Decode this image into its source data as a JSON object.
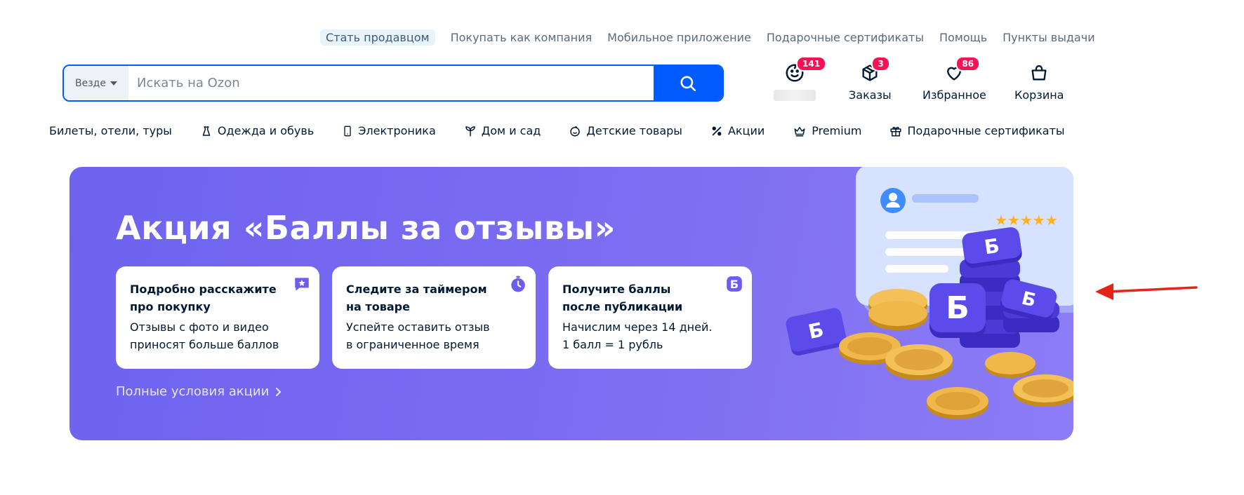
{
  "top_links": [
    {
      "label": "Стать продавцом"
    },
    {
      "label": "Покупать как компания"
    },
    {
      "label": "Мобильное приложение"
    },
    {
      "label": "Подарочные сертификаты"
    },
    {
      "label": "Помощь"
    },
    {
      "label": "Пункты выдачи"
    }
  ],
  "search": {
    "scope": "Везде",
    "placeholder": "Искать на Ozon",
    "value": "",
    "button_icon": "search-icon"
  },
  "header": {
    "profile": {
      "badge": "141",
      "icon": "face-icon"
    },
    "orders": {
      "badge": "3",
      "label": "Заказы",
      "icon": "box-icon"
    },
    "favorites": {
      "badge": "86",
      "label": "Избранное",
      "icon": "heart-icon"
    },
    "cart": {
      "label": "Корзина",
      "icon": "bag-icon"
    }
  },
  "categories": [
    {
      "label": "Билеты, отели, туры",
      "icon": ""
    },
    {
      "label": "Одежда и обувь",
      "icon": "dress-icon"
    },
    {
      "label": "Электроника",
      "icon": "phone-icon"
    },
    {
      "label": "Дом и сад",
      "icon": "sprout-icon"
    },
    {
      "label": "Детские товары",
      "icon": "baby-icon"
    },
    {
      "label": "Акции",
      "icon": "percent-icon"
    },
    {
      "label": "Premium",
      "icon": "crown-icon"
    },
    {
      "label": "Подарочные сертификаты",
      "icon": "gift-icon"
    }
  ],
  "banner": {
    "title": "Акция «Баллы за отзывы»",
    "cards": [
      {
        "title": "Подробно расскажите про покупку",
        "desc1": "Отзывы с фото и видео",
        "desc2": "приносят больше баллов",
        "icon": "star-chat-icon"
      },
      {
        "title": "Следите за таймером на товаре",
        "desc1": "Успейте оставить отзыв",
        "desc2": "в ограниченное время",
        "icon": "timer-icon"
      },
      {
        "title": "Получите баллы после публикации",
        "desc1": "Начислим через 14 дней.",
        "desc2": "1 балл = 1 рубль",
        "icon": "points-icon"
      }
    ],
    "more_link": "Полные условия акции",
    "badge_letter": "Б"
  },
  "colors": {
    "accent": "#005bff",
    "badge": "#f91155",
    "banner": "#7b6cf2",
    "arrow": "#e5231b"
  }
}
